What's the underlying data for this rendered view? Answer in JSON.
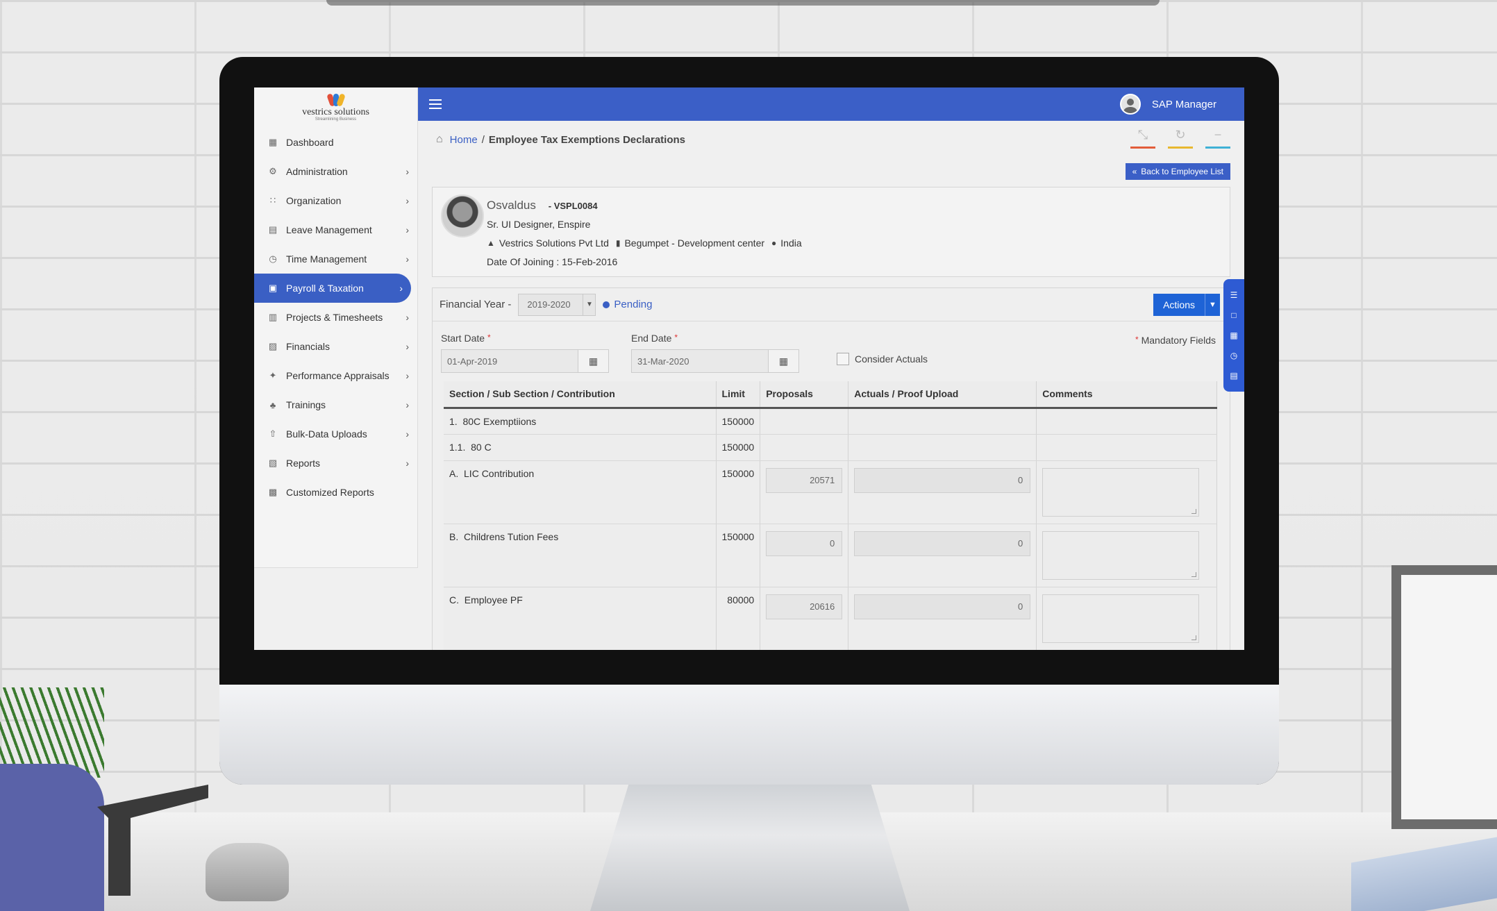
{
  "brand": {
    "name": "vestrics solutions",
    "tagline": "Streamlining Business"
  },
  "sidebar": {
    "items": [
      {
        "label": "Dashboard",
        "icon": "dashboard-icon",
        "chevron": false,
        "active": false
      },
      {
        "label": "Administration",
        "icon": "settings-icon",
        "chevron": true,
        "active": false
      },
      {
        "label": "Organization",
        "icon": "sitemap-icon",
        "chevron": true,
        "active": false
      },
      {
        "label": "Leave Management",
        "icon": "calendar-icon",
        "chevron": true,
        "active": false
      },
      {
        "label": "Time Management",
        "icon": "clock-icon",
        "chevron": true,
        "active": false
      },
      {
        "label": "Payroll & Taxation",
        "icon": "payroll-icon",
        "chevron": true,
        "active": true
      },
      {
        "label": "Projects & Timesheets",
        "icon": "projects-icon",
        "chevron": true,
        "active": false
      },
      {
        "label": "Financials",
        "icon": "financials-icon",
        "chevron": true,
        "active": false
      },
      {
        "label": "Performance Appraisals",
        "icon": "appraisal-icon",
        "chevron": true,
        "active": false
      },
      {
        "label": "Trainings",
        "icon": "trainings-icon",
        "chevron": true,
        "active": false
      },
      {
        "label": "Bulk-Data Uploads",
        "icon": "upload-icon",
        "chevron": true,
        "active": false
      },
      {
        "label": "Reports",
        "icon": "reports-icon",
        "chevron": true,
        "active": false
      },
      {
        "label": "Customized Reports",
        "icon": "custom-reports-icon",
        "chevron": false,
        "active": false
      }
    ]
  },
  "topbar": {
    "user_name": "SAP Manager"
  },
  "breadcrumb": {
    "home": "Home",
    "separator": "/",
    "current": "Employee Tax Exemptions Declarations"
  },
  "back_button": "Back to Employee List",
  "employee": {
    "name": "Osvaldus",
    "code": "- VSPL0084",
    "designation": "Sr. UI Designer, Enspire",
    "company": "Vestrics Solutions Pvt Ltd",
    "branch": "Begumpet - Development center",
    "country": "India",
    "joining": "Date Of Joining : 15-Feb-2016"
  },
  "declaration": {
    "fy_label": "Financial Year -",
    "fy_value": "2019-2020",
    "status": "Pending",
    "actions_label": "Actions",
    "start_label": "Start Date",
    "start_value": "01-Apr-2019",
    "end_label": "End Date",
    "end_value": "31-Mar-2020",
    "consider_actuals": "Consider Actuals",
    "mandatory": "Mandatory Fields",
    "required_mark": "*"
  },
  "table": {
    "headers": [
      "Section / Sub Section / Contribution",
      "Limit",
      "Proposals",
      "Actuals / Proof Upload",
      "Comments"
    ],
    "rows": [
      {
        "num": "1.",
        "label": "80C Exemptiions",
        "limit": "150000"
      },
      {
        "num": "1.1.",
        "label": "80 C",
        "limit": "150000"
      },
      {
        "num": "A.",
        "label": "LIC Contribution",
        "limit": "150000",
        "proposal": "20571",
        "actual": "0"
      },
      {
        "num": "B.",
        "label": "Childrens Tution Fees",
        "limit": "150000",
        "proposal": "0",
        "actual": "0"
      },
      {
        "num": "C.",
        "label": "Employee PF",
        "limit": "80000",
        "proposal": "20616",
        "actual": "0"
      }
    ]
  },
  "colors": {
    "primary": "#3b5fc7",
    "actions": "#1e63d6",
    "status": "#3a5fc4"
  }
}
